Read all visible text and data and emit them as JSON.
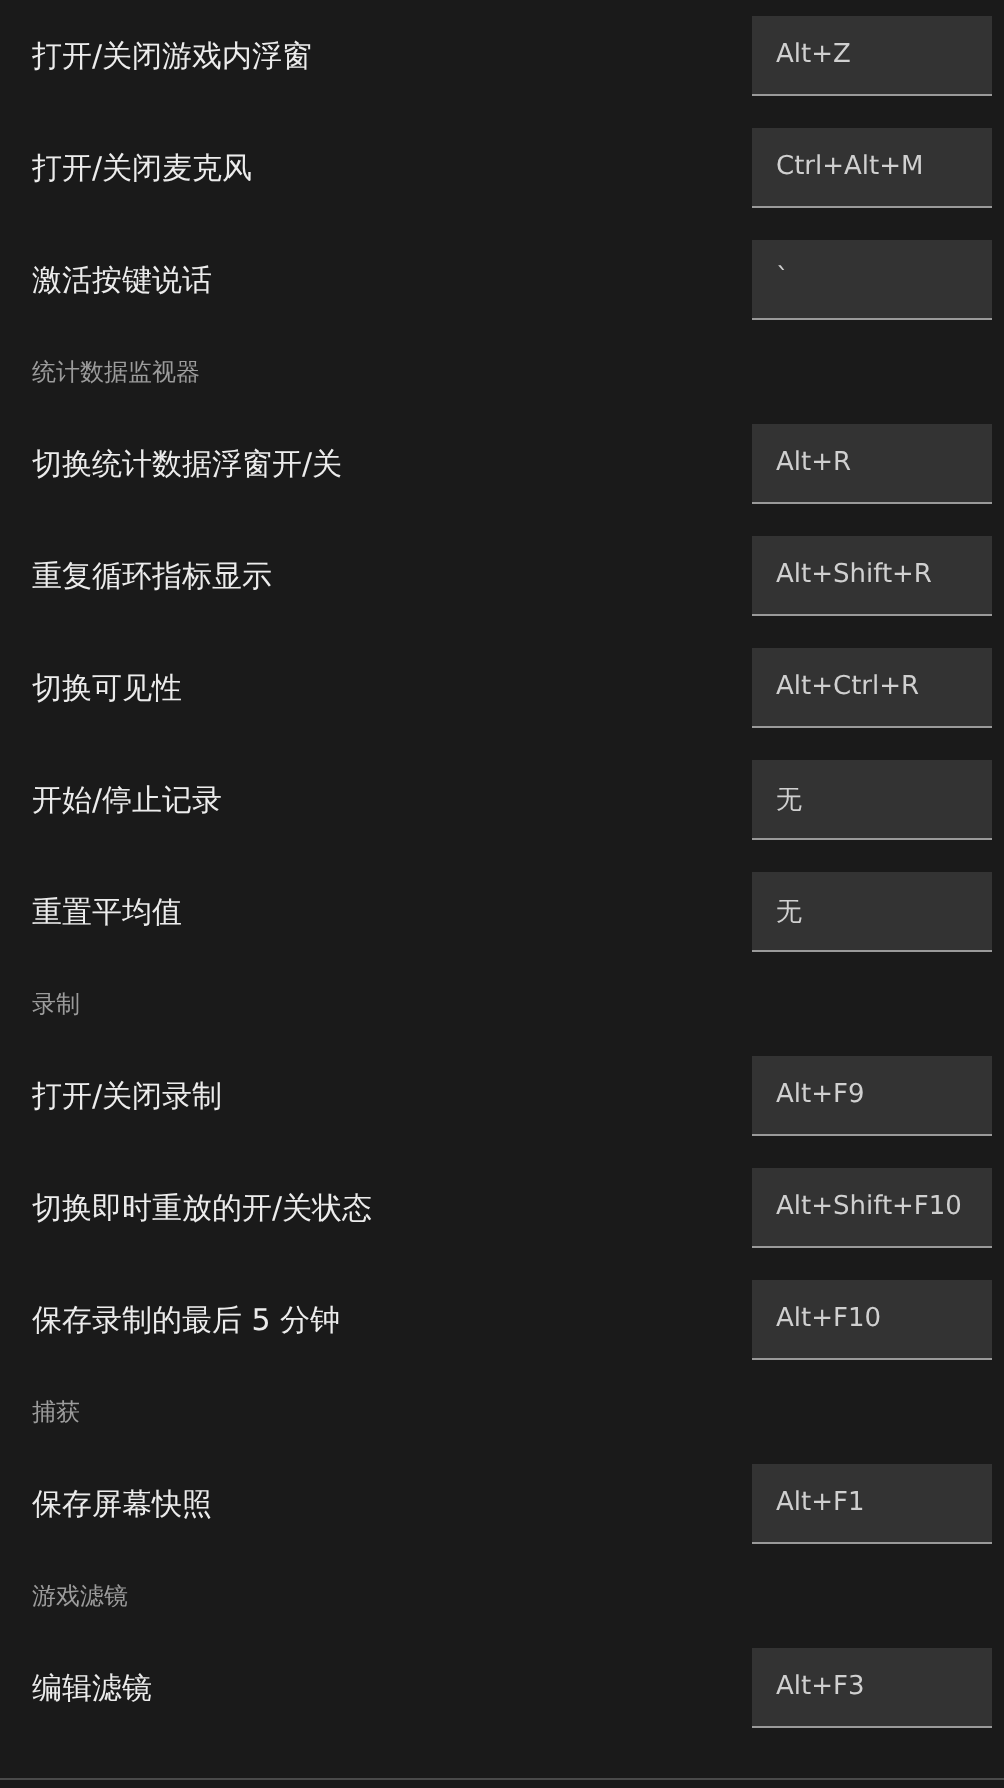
{
  "items": [
    {
      "kind": "shortcut",
      "label": "打开/关闭游戏内浮窗",
      "value": "Alt+Z"
    },
    {
      "kind": "shortcut",
      "label": "打开/关闭麦克风",
      "value": "Ctrl+Alt+M"
    },
    {
      "kind": "shortcut",
      "label": "激活按键说话",
      "value": "`"
    },
    {
      "kind": "header",
      "label": "统计数据监视器"
    },
    {
      "kind": "shortcut",
      "label": "切换统计数据浮窗开/关",
      "value": "Alt+R"
    },
    {
      "kind": "shortcut",
      "label": "重复循环指标显示",
      "value": "Alt+Shift+R"
    },
    {
      "kind": "shortcut",
      "label": "切换可见性",
      "value": "Alt+Ctrl+R"
    },
    {
      "kind": "shortcut",
      "label": "开始/停止记录",
      "value": "无"
    },
    {
      "kind": "shortcut",
      "label": "重置平均值",
      "value": "无"
    },
    {
      "kind": "header",
      "label": "录制"
    },
    {
      "kind": "shortcut",
      "label": "打开/关闭录制",
      "value": "Alt+F9"
    },
    {
      "kind": "shortcut",
      "label": "切换即时重放的开/关状态",
      "value": "Alt+Shift+F10"
    },
    {
      "kind": "shortcut",
      "label": "保存录制的最后 5 分钟",
      "value": "Alt+F10"
    },
    {
      "kind": "header",
      "label": "捕获"
    },
    {
      "kind": "shortcut",
      "label": "保存屏幕快照",
      "value": "Alt+F1"
    },
    {
      "kind": "header",
      "label": "游戏滤镜"
    },
    {
      "kind": "shortcut",
      "label": "编辑滤镜",
      "value": "Alt+F3"
    }
  ]
}
